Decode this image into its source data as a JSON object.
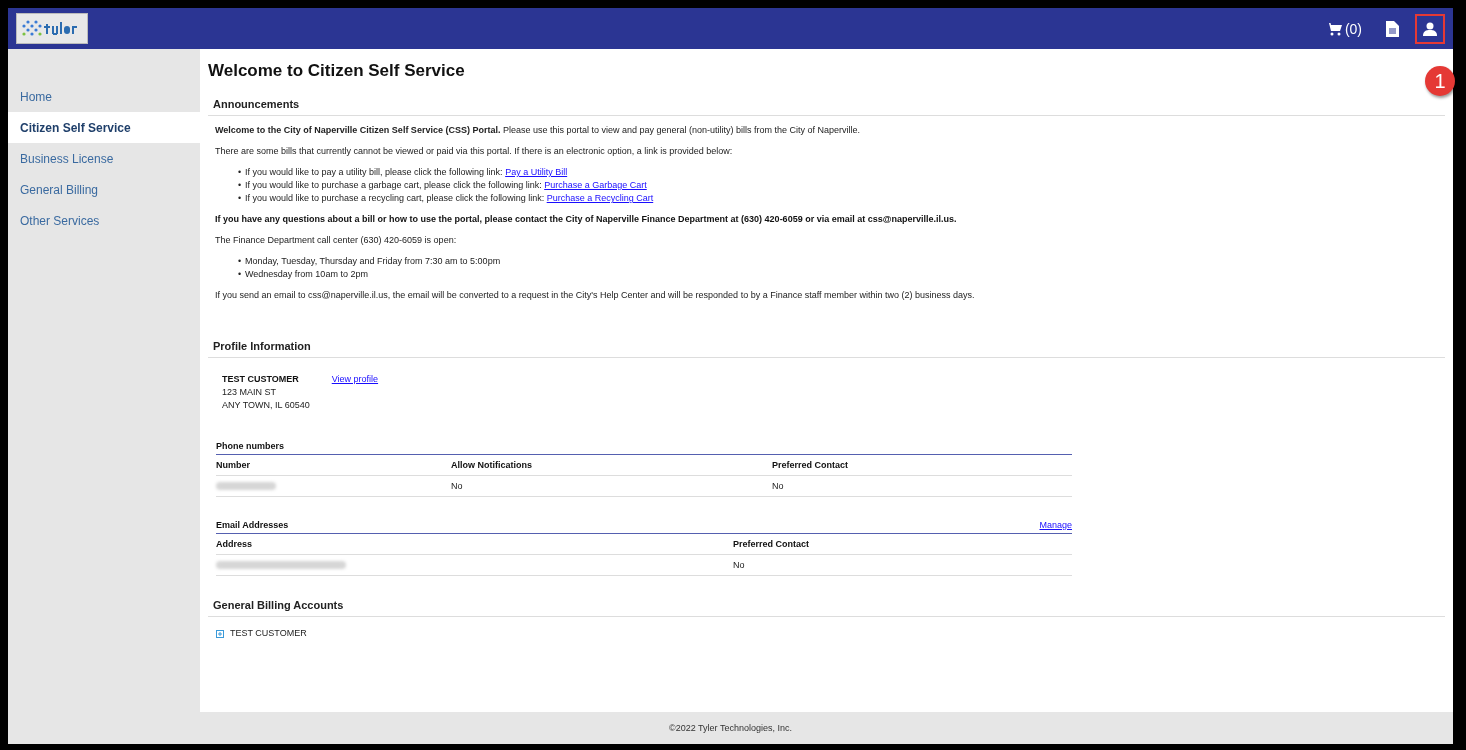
{
  "header": {
    "cart_count": "(0)",
    "user_highlighted": true,
    "annotation_badge": "1"
  },
  "sidebar": {
    "items": [
      {
        "label": "Home",
        "selected": false
      },
      {
        "label": "Citizen Self Service",
        "selected": true
      },
      {
        "label": "Business License",
        "selected": false
      },
      {
        "label": "General Billing",
        "selected": false
      },
      {
        "label": "Other Services",
        "selected": false
      }
    ]
  },
  "page_title": "Welcome to Citizen Self Service",
  "announcements": {
    "heading": "Announcements",
    "blocks": [
      {
        "kind": "paragraph",
        "text": "**Welcome to the City of Naperville Citizen Self Service (CSS) Portal.**  Please use this portal to view and pay general (non-utility) bills from the City of Naperville."
      },
      {
        "kind": "paragraph",
        "text": "There are some bills that currently cannot be viewed or paid via this portal.  If there is an electronic option, a link is provided below:"
      },
      {
        "kind": "list",
        "bullet": "•",
        "items": [
          {
            "text": "If you would like to pay a utility bill, please click the following link:",
            "link": "Pay a Utility Bill"
          },
          {
            "text": "If you would like to purchase a garbage cart, please click the following link:",
            "link": "Purchase a Garbage Cart"
          },
          {
            "text": "If you would like to purchase a recycling cart, please click the following link:",
            "link": "Purchase a Recycling Cart"
          }
        ]
      },
      {
        "kind": "bold",
        "text": "If you have any questions about a bill or how to use the portal, please contact the City of Naperville Finance Department at (630) 420-6059 or via email at css@naperville.il.us."
      },
      {
        "kind": "paragraph",
        "text": "The Finance Department call center (630) 420-6059 is open:"
      },
      {
        "kind": "list",
        "bullet": "•",
        "items": [
          {
            "text": "Monday, Tuesday, Thursday and Friday from 7:30 am to 5:00pm"
          },
          {
            "text": "Wednesday from 10am to 2pm"
          }
        ]
      },
      {
        "kind": "paragraph",
        "text": "If you send an email to css@naperville.il.us, the email will be converted to a request in the City's Help Center and will be  responded to by a Finance staff member within two (2) business days."
      }
    ]
  },
  "profile": {
    "heading": "Profile Information",
    "name": "TEST CUSTOMER",
    "view_link": "View profile",
    "address_lines": [
      "123 MAIN ST",
      "ANY TOWN, IL 60540"
    ],
    "tables": [
      {
        "title": "Phone numbers",
        "columns": [
          "Number",
          "Allow Notifications",
          "Preferred Contact"
        ],
        "rows": [
          [
            {
              "kind": "redacted"
            },
            {
              "kind": "text",
              "text": "No"
            },
            {
              "kind": "text",
              "text": "No"
            }
          ]
        ]
      },
      {
        "title": "Email Addresses",
        "action": "Manage",
        "columns": [
          "Address",
          "Preferred Contact"
        ],
        "rows": [
          [
            {
              "kind": "redacted"
            },
            {
              "kind": "text",
              "text": "No"
            }
          ]
        ]
      }
    ]
  },
  "billing": {
    "heading": "General Billing Accounts",
    "accounts": [
      {
        "label": "TEST CUSTOMER",
        "expanded": false
      }
    ]
  },
  "footer": "©2022 Tyler Technologies, Inc."
}
